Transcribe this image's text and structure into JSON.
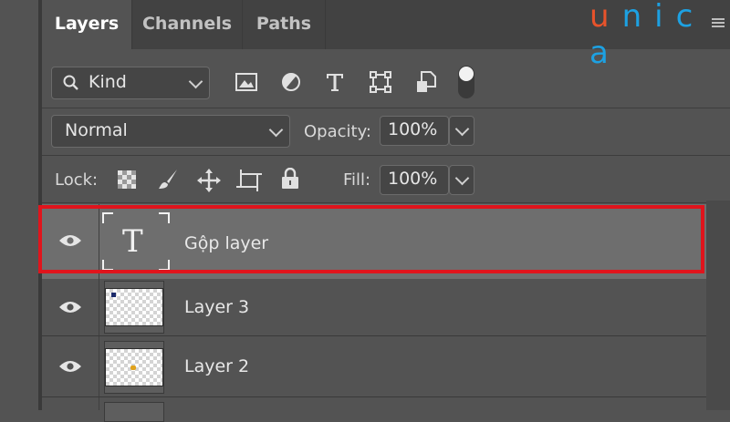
{
  "tabs": [
    {
      "label": "Layers",
      "active": true
    },
    {
      "label": "Channels",
      "active": false
    },
    {
      "label": "Paths",
      "active": false
    }
  ],
  "logo": {
    "letters": [
      "u",
      "n",
      "i",
      "c",
      "a"
    ],
    "colors": [
      "#e8532b",
      "#1da1e2",
      "#1da1e2",
      "#1da1e2",
      "#1da1e2"
    ]
  },
  "filter": {
    "kind_label": "Kind"
  },
  "blend": {
    "mode": "Normal",
    "opacity_label": "Opacity:",
    "opacity_value": "100%"
  },
  "lock": {
    "label": "Lock:",
    "fill_label": "Fill:",
    "fill_value": "100%"
  },
  "layers": [
    {
      "name": "Gộp layer",
      "type": "text",
      "selected": true,
      "thumb_glyph": "T"
    },
    {
      "name": "Layer 3",
      "type": "raster",
      "selected": false
    },
    {
      "name": "Layer 2",
      "type": "raster",
      "selected": false
    }
  ],
  "colors": {
    "highlight": "#e0141c",
    "panel": "#535353",
    "selected_row": "#6e6e6e"
  }
}
